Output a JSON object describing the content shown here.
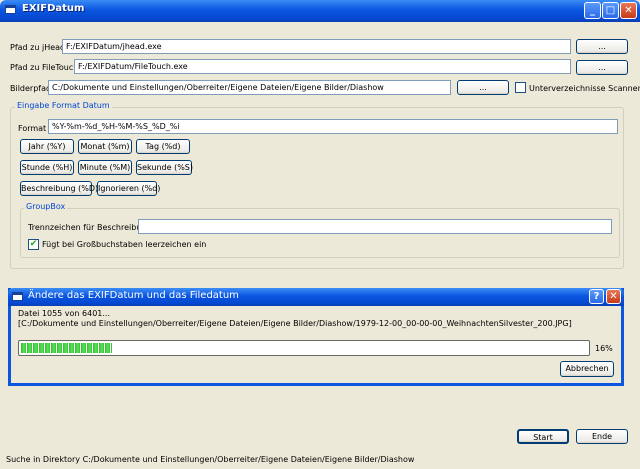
{
  "window": {
    "title": "EXIFDatum"
  },
  "paths": {
    "jhead_label": "Pfad zu jHead",
    "jhead_value": "F:/EXIFDatum/jhead.exe",
    "filetouch_label": "Pfad zu FileTouch",
    "filetouch_value": "F:/EXIFDatum/FileTouch.exe",
    "bilder_label": "Bilderpfad",
    "bilder_value": "C:/Dokumente und Einstellungen/Oberreiter/Eigene Dateien/Eigene Bilder/Diashow",
    "browse_label": "...",
    "subdirs_label": "Unterverzeichnisse Scannen",
    "subdirs_checked": false
  },
  "format_group": {
    "title": "Eingabe Format Datum",
    "format_label": "Format",
    "format_value": "%Y-%m-%d_%H-%M-%S_%D_%i",
    "buttons": [
      "Jahr (%Y)",
      "Monat (%m)",
      "Tag (%d)",
      "Stunde (%H)",
      "Minute (%M)",
      "Sekunde (%S)",
      "Beschreibung (%D)",
      "Ignorieren (%d)"
    ]
  },
  "groupbox": {
    "title": "GroupBox",
    "trenn_label": "Trennzeichen für Beschreibung",
    "trenn_value": "",
    "gross_label": "Fügt bei Großbuchstaben leerzeichen ein",
    "gross_checked": true
  },
  "dialog": {
    "title": "Ändere das EXIFDatum und das Filedatum",
    "status_line": "Datei 1055 von 6401...",
    "file_line": "[C:/Dokumente und Einstellungen/Oberreiter/Eigene Dateien/Eigene Bilder/Diashow/1979-12-00_00-00-00_WeihnachtenSilvester_200.JPG]",
    "progress_percent": 16,
    "progress_text": "16%",
    "cancel_label": "Abbrechen"
  },
  "actions": {
    "start_label": "Start",
    "end_label": "Ende"
  },
  "statusbar": {
    "text": "Suche in Direktory C:/Dokumente und Einstellungen/Oberreiter/Eigene Dateien/Eigene Bilder/Diashow"
  }
}
